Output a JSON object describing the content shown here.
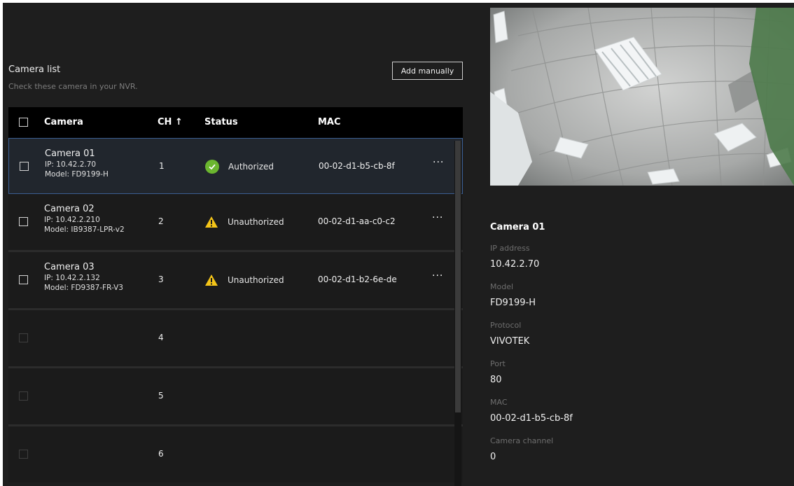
{
  "camera_list": {
    "title": "Camera list",
    "subtitle": "Check these camera in your NVR.",
    "add_button": "Add manually",
    "columns": {
      "camera": "Camera",
      "ch": "CH ↑",
      "status": "Status",
      "mac": "MAC"
    },
    "rows": [
      {
        "name": "Camera 01",
        "ip": "IP: 10.42.2.70",
        "model": "Model: FD9199-H",
        "ch": "1",
        "status": "Authorized",
        "status_icon": "check-circle-icon",
        "mac": "00-02-d1-b5-cb-8f",
        "more": "···",
        "selected": true
      },
      {
        "name": "Camera 02",
        "ip": "IP: 10.42.2.210",
        "model": "Model: IB9387-LPR-v2",
        "ch": "2",
        "status": "Unauthorized",
        "status_icon": "warning-icon",
        "mac": "00-02-d1-aa-c0-c2",
        "more": "···",
        "selected": false
      },
      {
        "name": "Camera 03",
        "ip": "IP: 10.42.2.132",
        "model": "Model: FD9387-FR-V3",
        "ch": "3",
        "status": "Unauthorized",
        "status_icon": "warning-icon",
        "mac": "00-02-d1-b2-6e-de",
        "more": "···",
        "selected": false
      },
      {
        "ch": "4"
      },
      {
        "ch": "5"
      },
      {
        "ch": "6"
      }
    ]
  },
  "details": {
    "title": "Camera 01",
    "fields": [
      {
        "label": "IP address",
        "value": "10.42.2.70"
      },
      {
        "label": "Model",
        "value": "FD9199-H"
      },
      {
        "label": "Protocol",
        "value": "VIVOTEK"
      },
      {
        "label": "Port",
        "value": "80"
      },
      {
        "label": "MAC",
        "value": "00-02-d1-b5-cb-8f"
      },
      {
        "label": "Camera channel",
        "value": "0"
      }
    ]
  },
  "colors": {
    "background": "#1e1e1e",
    "header": "#000000",
    "selected_border": "#3b5f93",
    "authorized": "#6bb62f",
    "warning": "#f5c518"
  }
}
